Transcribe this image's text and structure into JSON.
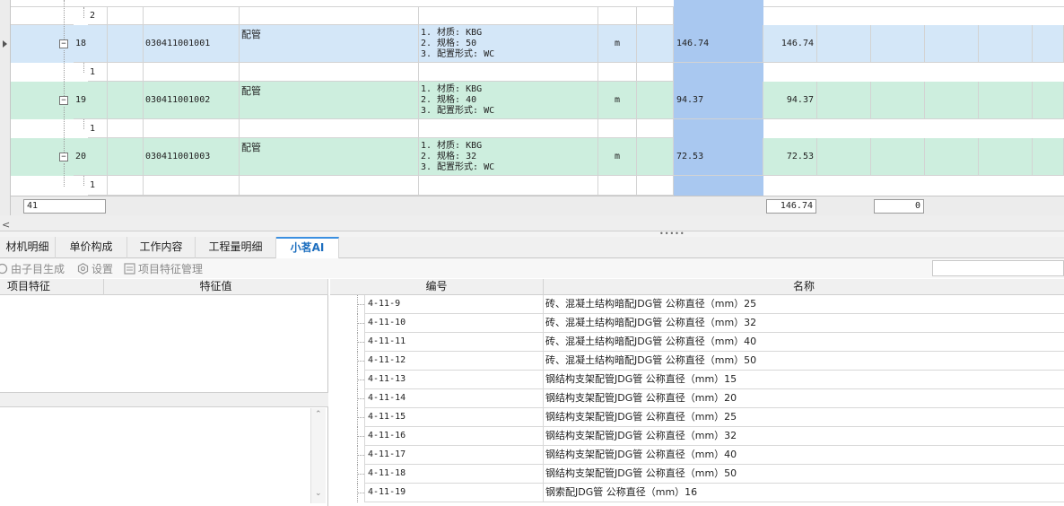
{
  "grid": {
    "rows": [
      {
        "type": "child",
        "index": "2",
        "bg": "white"
      },
      {
        "type": "item",
        "seq": "18",
        "code": "030411001001",
        "name": "配管",
        "features": [
          "1. 材质: KBG",
          "2. 规格: 50",
          "3. 配置形式: WC"
        ],
        "unit": "m",
        "qty": "146.74",
        "qty2": "146.74",
        "bg": "blue",
        "selected": true
      },
      {
        "type": "child",
        "index": "1",
        "bg": "white"
      },
      {
        "type": "item",
        "seq": "19",
        "code": "030411001002",
        "name": "配管",
        "features": [
          "1. 材质: KBG",
          "2. 规格: 40",
          "3. 配置形式: WC"
        ],
        "unit": "m",
        "qty": "94.37",
        "qty2": "94.37",
        "bg": "green"
      },
      {
        "type": "child",
        "index": "1",
        "bg": "white"
      },
      {
        "type": "item",
        "seq": "20",
        "code": "030411001003",
        "name": "配管",
        "features": [
          "1. 材质: KBG",
          "2. 规格: 32",
          "3. 配置形式: WC"
        ],
        "unit": "m",
        "qty": "72.53",
        "qty2": "72.53",
        "bg": "green"
      },
      {
        "type": "child",
        "index": "1",
        "bg": "white"
      }
    ],
    "footer": {
      "count": "41",
      "total": "146.74",
      "zero": "0"
    }
  },
  "tabs": [
    {
      "label": "材机明细",
      "active": false
    },
    {
      "label": "单价构成",
      "active": false
    },
    {
      "label": "工作内容",
      "active": false
    },
    {
      "label": "工程量明细",
      "active": false
    },
    {
      "label": "小茗AI",
      "active": true
    }
  ],
  "toolbar": {
    "sub_generate": "由子目生成",
    "settings": "设置",
    "feature_manage": "项目特征管理"
  },
  "left_panel": {
    "col_feature": "项目特征",
    "col_value": "特征值"
  },
  "right_panel": {
    "col_code": "编号",
    "col_name": "名称",
    "rows": [
      {
        "code": "4-11-9",
        "name": "砖、混凝土结构暗配JDG管 公称直径（mm）25"
      },
      {
        "code": "4-11-10",
        "name": "砖、混凝土结构暗配JDG管 公称直径（mm）32"
      },
      {
        "code": "4-11-11",
        "name": "砖、混凝土结构暗配JDG管 公称直径（mm）40"
      },
      {
        "code": "4-11-12",
        "name": "砖、混凝土结构暗配JDG管 公称直径（mm）50"
      },
      {
        "code": "4-11-13",
        "name": "钢结构支架配管JDG管 公称直径（mm）15"
      },
      {
        "code": "4-11-14",
        "name": "钢结构支架配管JDG管 公称直径（mm）20"
      },
      {
        "code": "4-11-15",
        "name": "钢结构支架配管JDG管 公称直径（mm）25"
      },
      {
        "code": "4-11-16",
        "name": "钢结构支架配管JDG管 公称直径（mm）32"
      },
      {
        "code": "4-11-17",
        "name": "钢结构支架配管JDG管 公称直径（mm）40"
      },
      {
        "code": "4-11-18",
        "name": "钢结构支架配管JDG管 公称直径（mm）50"
      },
      {
        "code": "4-11-19",
        "name": "钢索配JDG管 公称直径（mm）16"
      }
    ]
  },
  "icons": {
    "row_pointer": "triangle-right-icon",
    "collapse": "minus-box-icon",
    "settings": "gear-icon",
    "feature_manage": "document-icon",
    "sub_generate": "circle-arrow-icon"
  },
  "colors": {
    "row_blue": "#d4e7f8",
    "row_green": "#cdeede",
    "highlight_column": "#a9c8f0",
    "active_tab": "#1e6fbf"
  }
}
